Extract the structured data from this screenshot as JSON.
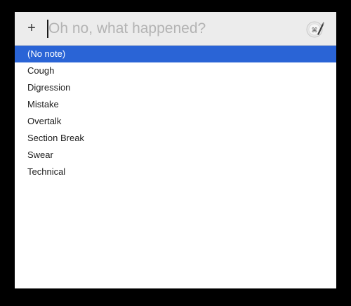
{
  "toolbar": {
    "add_label": "+",
    "search_placeholder": "Oh no, what happened?",
    "search_value": "",
    "app_icon": "note-marker-icon"
  },
  "list": {
    "items": [
      {
        "label": "(No note)",
        "selected": true
      },
      {
        "label": "Cough",
        "selected": false
      },
      {
        "label": "Digression",
        "selected": false
      },
      {
        "label": "Mistake",
        "selected": false
      },
      {
        "label": "Overtalk",
        "selected": false
      },
      {
        "label": "Section Break",
        "selected": false
      },
      {
        "label": "Swear",
        "selected": false
      },
      {
        "label": "Technical",
        "selected": false
      }
    ]
  },
  "colors": {
    "selection": "#2a64d6",
    "toolbar_bg": "#ececec",
    "backdrop": "#000000"
  }
}
